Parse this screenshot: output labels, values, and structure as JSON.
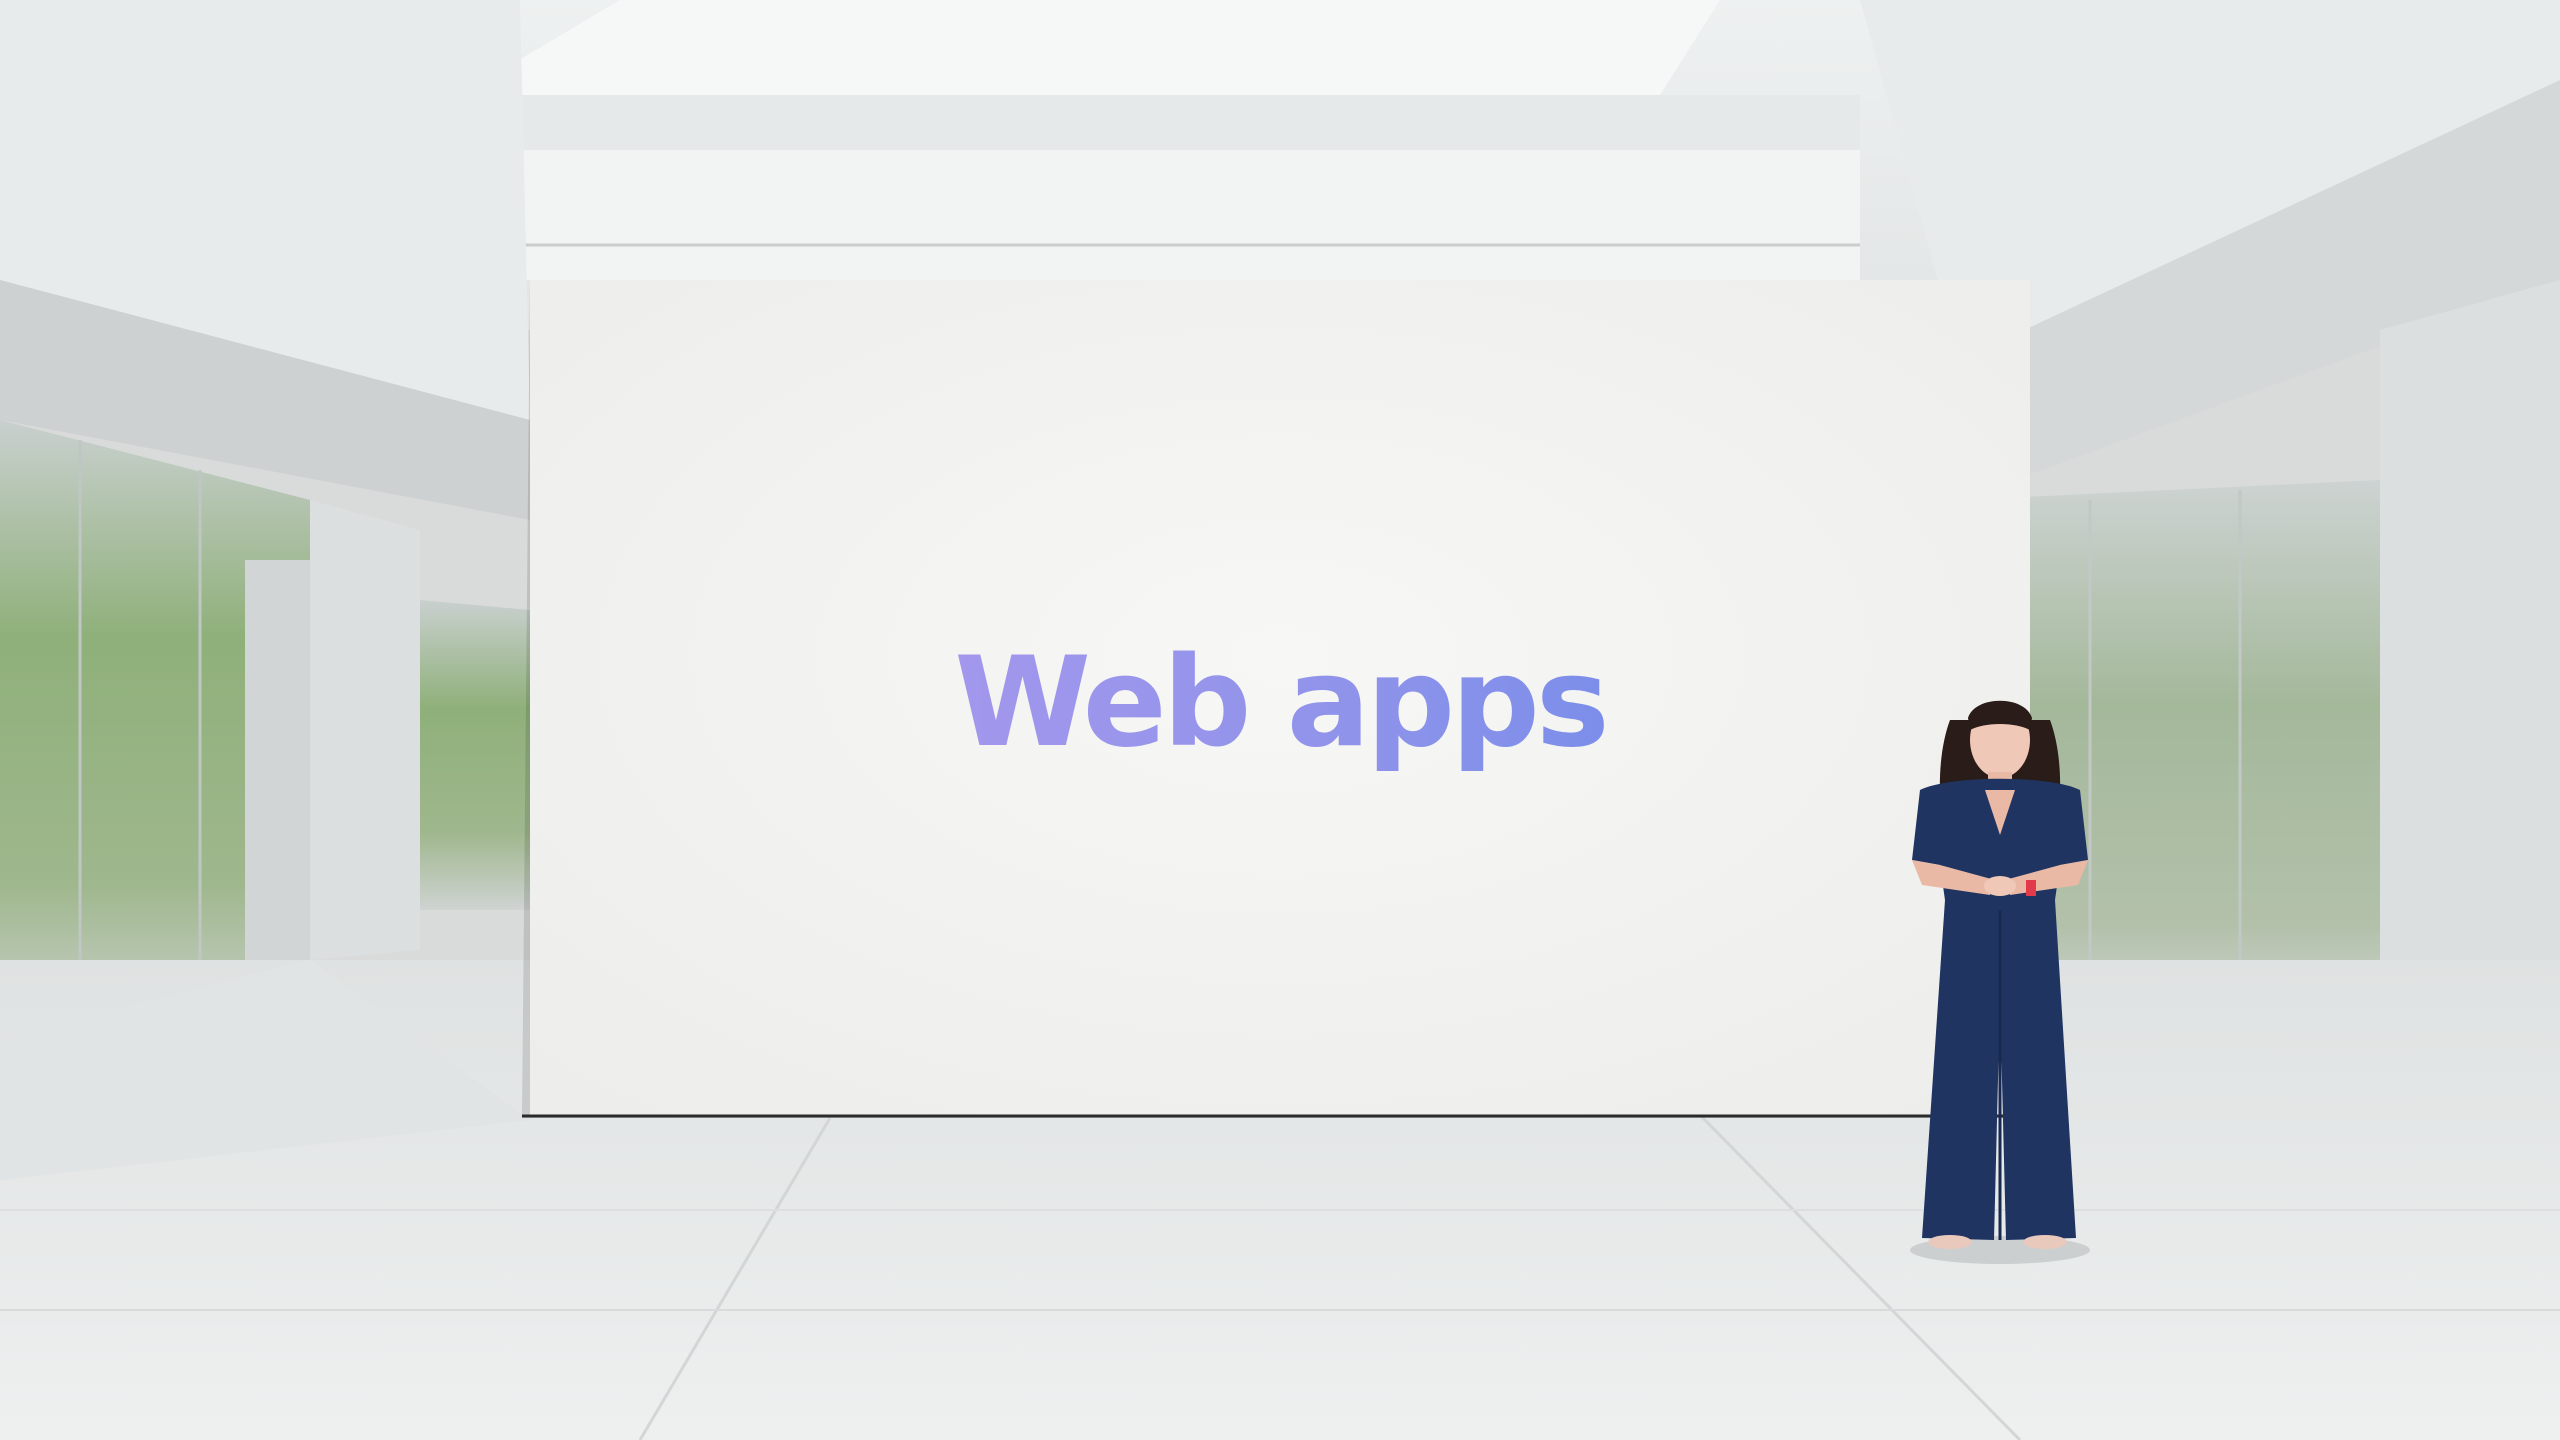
{
  "slide": {
    "title": "Web apps",
    "gradient": [
      "#b69cf0",
      "#8f93ea",
      "#5b86ea"
    ]
  },
  "colors": {
    "screen": "#f3f3f1",
    "floor": "#e4e6e6",
    "jumpsuit": "#1f3461",
    "hair": "#2a1c18",
    "watch_band": "#e33a4b",
    "foliage": "#6f9a52"
  }
}
